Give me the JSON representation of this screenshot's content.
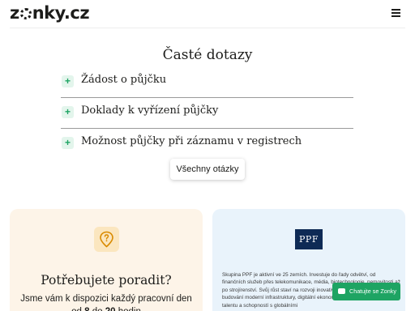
{
  "header": {
    "logo_pre": "z",
    "logo_post": "nky.cz",
    "menu_icon": "hamburger-menu-icon"
  },
  "faq": {
    "title": "Časté dotazy",
    "items": [
      {
        "label": "Žádost o půjčku",
        "icon": "plus-icon"
      },
      {
        "label": "Doklady k vyřízení půjčky",
        "icon": "plus-icon"
      },
      {
        "label": "Možnost půjčky při záznamu v registrech",
        "icon": "plus-icon"
      }
    ],
    "all_button": "Všechny otázky"
  },
  "advice": {
    "icon": "location-help-icon",
    "title": "Potřebujete poradit?",
    "line1": "Jsme vám k dispozici každý pracovní den",
    "line2_pre": "od ",
    "hour_from": "8",
    "line2_mid": " do ",
    "hour_to": "20",
    "line2_post": " hodin"
  },
  "ppf": {
    "logo": "PPF",
    "text": "Skupina PPF je aktivní ve 25 zemích. Investuje do řady odvětví, od finančních služeb přes telekomunikace, média, biotechnologie, nemovitosti až po strojírenství. Svůj růst staví na rozvoji inovativních a nových odvětví, budování moderní infrastruktury, digitální ekonomiky a propojení českého talentu a schopností s globálními"
  },
  "chat": {
    "label": "Chatujte se Zonky",
    "icon": "chat-bubble-icon"
  },
  "colors": {
    "accent": "#1ea463",
    "plus_bg": "#e3f5ec",
    "advice_card_bg": "#fdf4e8",
    "ppf_card_bg": "#e9f3fb",
    "ppf_logo_bg": "#0e2a55"
  }
}
